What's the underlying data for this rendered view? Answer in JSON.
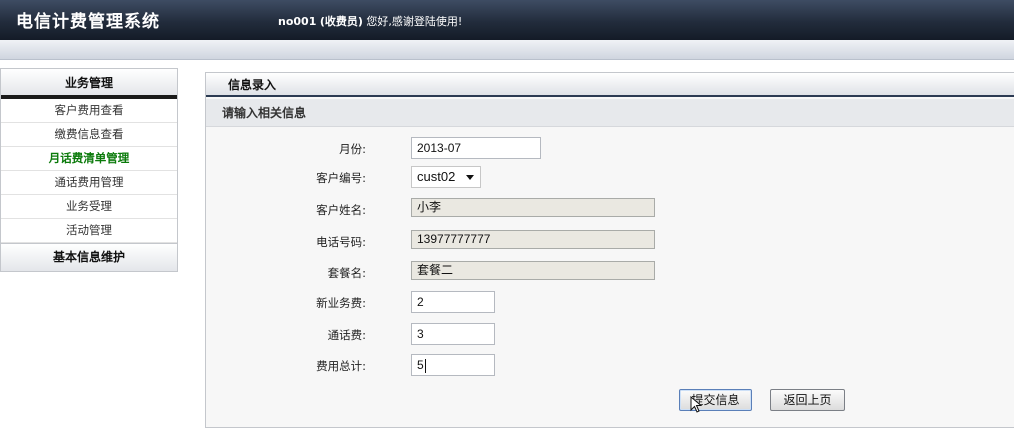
{
  "app": {
    "title": "电信计费管理系统",
    "user_id": "no001",
    "role": "(收费员)",
    "greeting": "您好,感谢登陆使用!"
  },
  "sidebar": {
    "header": "业务管理",
    "items": [
      {
        "label": "客户费用查看",
        "active": false
      },
      {
        "label": "缴费信息查看",
        "active": false
      },
      {
        "label": "月话费清单管理",
        "active": true
      },
      {
        "label": "通话费用管理",
        "active": false
      },
      {
        "label": "业务受理",
        "active": false
      },
      {
        "label": "活动管理",
        "active": false
      }
    ],
    "header2": "基本信息维护"
  },
  "content": {
    "header": "信息录入",
    "section_title": "请输入相关信息"
  },
  "form": {
    "month": {
      "label": "月份:",
      "value": "2013-07"
    },
    "customer_id": {
      "label": "客户编号:",
      "value": "cust02"
    },
    "customer_name": {
      "label": "客户姓名:",
      "value": "小李"
    },
    "phone": {
      "label": "电话号码:",
      "value": "13977777777"
    },
    "package": {
      "label": "套餐名:",
      "value": "套餐二"
    },
    "new_business_fee": {
      "label": "新业务费:",
      "value": "2"
    },
    "call_fee": {
      "label": "通话费:",
      "value": "3"
    },
    "total_fee": {
      "label": "费用总计:",
      "value": "5"
    }
  },
  "buttons": {
    "submit": "提交信息",
    "back": "返回上页"
  },
  "colors": {
    "topbar": "#222c3c",
    "active_menu": "#0a7a0a",
    "content_header_rule": "#2b3a52",
    "readonly_field": "#eae8e1"
  }
}
